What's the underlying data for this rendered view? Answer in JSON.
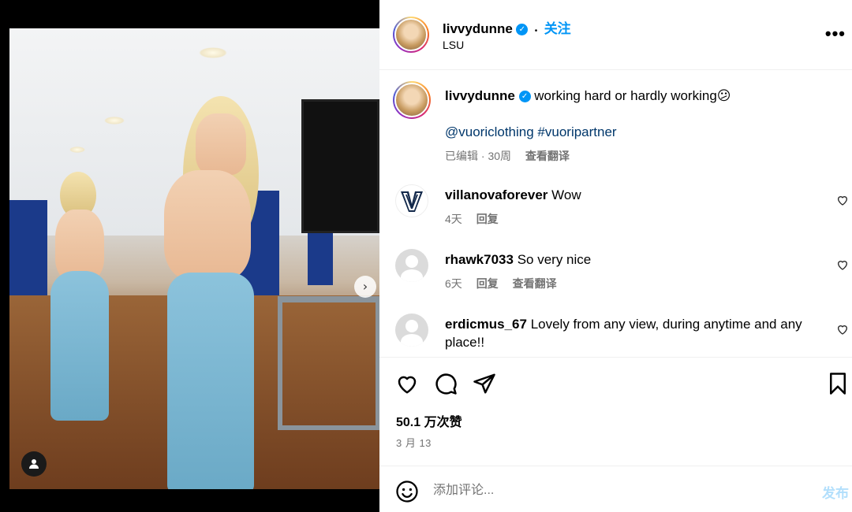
{
  "post": {
    "author": "livvydunne",
    "location": "LSU",
    "follow_label": "关注",
    "separator": "•",
    "more_label": "•••"
  },
  "caption": {
    "author": "livvydunne",
    "text": "working hard or hardly working😕",
    "tags": "@vuoriclothing #vuoripartner",
    "meta_edited": "已编辑 · 30周",
    "meta_translate": "查看翻译"
  },
  "comments": [
    {
      "user": "villanovaforever",
      "text": "Wow",
      "time": "4天",
      "reply": "回复",
      "translate": ""
    },
    {
      "user": "rhawk7033",
      "text": "So very nice",
      "time": "6天",
      "reply": "回复",
      "translate": "查看翻译"
    },
    {
      "user": "erdicmus_67",
      "text": "Lovely from any view, during anytime and any place!!",
      "time": "",
      "reply": "",
      "translate": ""
    }
  ],
  "stats": {
    "likes": "50.1 万次赞",
    "date": "3 月 13"
  },
  "composer": {
    "placeholder": "添加评论...",
    "post_label": "发布"
  },
  "carousel": {
    "next_glyph": "›",
    "page_count": 2,
    "current_page": 1
  },
  "colors": {
    "accent": "#0095f6",
    "link": "#00376b",
    "muted": "#737373",
    "post_disabled": "#b2dffc"
  },
  "icons": [
    "heart-icon",
    "comment-icon",
    "share-icon",
    "bookmark-icon",
    "emoji-icon",
    "user-tag-icon",
    "chevron-right-icon",
    "verified-icon"
  ]
}
